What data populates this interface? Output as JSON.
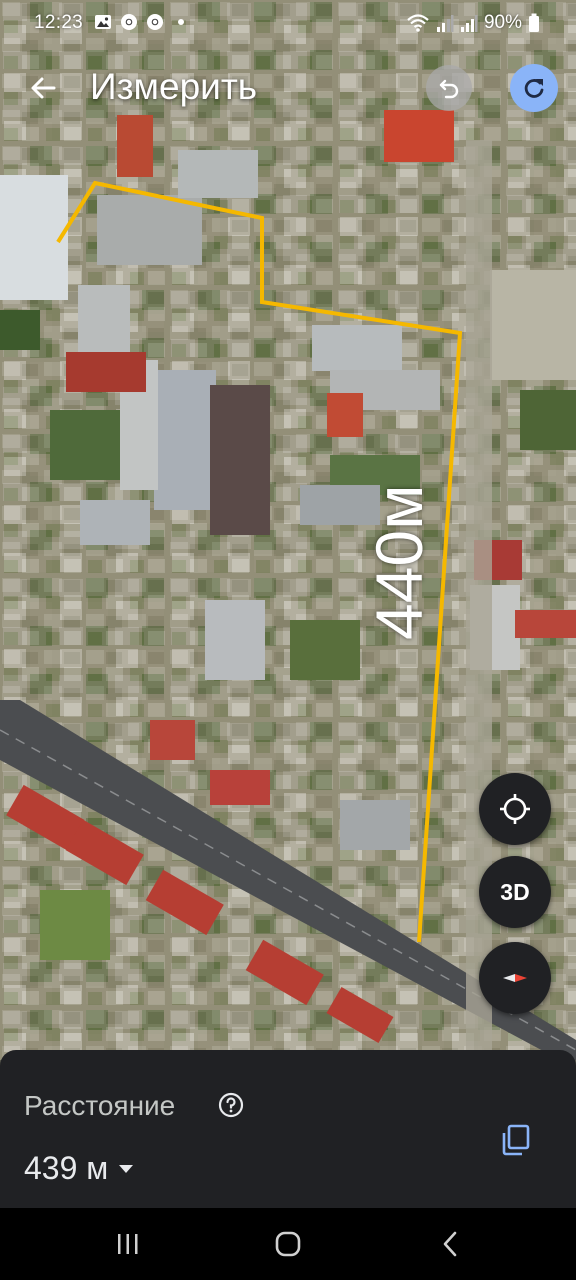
{
  "status_bar": {
    "time": "12:23",
    "battery": "90%",
    "left_icons": [
      "image-icon",
      "chrome-icon",
      "chrome-icon",
      "dot-icon"
    ],
    "right_icons": [
      "wifi-icon",
      "signal-icon",
      "signal-icon",
      "battery-icon"
    ]
  },
  "header": {
    "title": "Измерить",
    "back_icon": "arrow-left-icon",
    "undo_icon": "undo-icon",
    "redo_icon": "redo-icon",
    "redo_color": "#8ab4f8"
  },
  "map": {
    "segment_label": "440м",
    "path_color": "#f5b800"
  },
  "controls": {
    "locate_icon": "crosshair-icon",
    "mode_label": "3D",
    "compass_icon": "compass-icon"
  },
  "sheet": {
    "label": "Расстояние",
    "value": "439 м",
    "help_icon": "help-circle-icon",
    "dropdown_icon": "caret-down-icon",
    "copy_icon": "copy-icon"
  },
  "navbar": {
    "icons": [
      "recents-icon",
      "home-icon",
      "back-icon"
    ]
  }
}
